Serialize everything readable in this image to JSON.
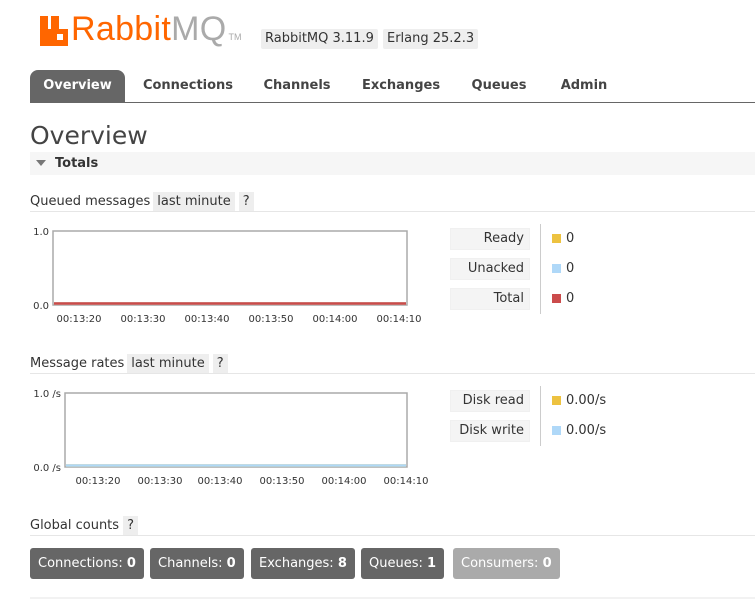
{
  "header": {
    "logo_primary": "Rabbit",
    "logo_secondary": "MQ",
    "logo_tm": "TM",
    "version_rabbitmq": "RabbitMQ 3.11.9",
    "version_erlang": "Erlang 25.2.3"
  },
  "tabs": [
    {
      "label": "Overview",
      "active": true
    },
    {
      "label": "Connections",
      "active": false
    },
    {
      "label": "Channels",
      "active": false
    },
    {
      "label": "Exchanges",
      "active": false
    },
    {
      "label": "Queues",
      "active": false
    },
    {
      "label": "Admin",
      "active": false
    }
  ],
  "page_title": "Overview",
  "section": {
    "label": "Totals"
  },
  "queued": {
    "label": "Queued messages",
    "range": "last minute",
    "help": "?",
    "legend": [
      {
        "label": "Ready",
        "value": "0",
        "color": "#edc240"
      },
      {
        "label": "Unacked",
        "value": "0",
        "color": "#afd8f8"
      },
      {
        "label": "Total",
        "value": "0",
        "color": "#cb4b4b"
      }
    ]
  },
  "rates": {
    "label": "Message rates",
    "range": "last minute",
    "help": "?",
    "legend": [
      {
        "label": "Disk read",
        "value": "0.00/s",
        "color": "#edc240"
      },
      {
        "label": "Disk write",
        "value": "0.00/s",
        "color": "#afd8f8"
      }
    ]
  },
  "global": {
    "label": "Global counts",
    "help": "?",
    "counts": [
      {
        "label": "Connections:",
        "value": "0",
        "disabled": false
      },
      {
        "label": "Channels:",
        "value": "0",
        "disabled": false
      },
      {
        "label": "Exchanges:",
        "value": "8",
        "disabled": false
      },
      {
        "label": "Queues:",
        "value": "1",
        "disabled": false
      },
      {
        "label": "Consumers:",
        "value": "0",
        "disabled": true
      }
    ]
  },
  "chart_data": [
    {
      "type": "line",
      "x": [
        "00:13:20",
        "00:13:30",
        "00:13:40",
        "00:13:50",
        "00:14:00",
        "00:14:10"
      ],
      "ylim": [
        0.0,
        1.0
      ],
      "ytick_labels": [
        "1.0",
        "0.0"
      ],
      "series": [
        {
          "name": "Ready",
          "values": [
            0,
            0,
            0,
            0,
            0,
            0
          ],
          "color": "#edc240"
        },
        {
          "name": "Unacked",
          "values": [
            0,
            0,
            0,
            0,
            0,
            0
          ],
          "color": "#afd8f8"
        },
        {
          "name": "Total",
          "values": [
            0,
            0,
            0,
            0,
            0,
            0
          ],
          "color": "#cb4b4b"
        }
      ]
    },
    {
      "type": "line",
      "x": [
        "00:13:20",
        "00:13:30",
        "00:13:40",
        "00:13:50",
        "00:14:00",
        "00:14:10"
      ],
      "ylim": [
        0.0,
        1.0
      ],
      "ytick_labels": [
        "1.0 /s",
        "0.0 /s"
      ],
      "series": [
        {
          "name": "Disk read",
          "values": [
            0,
            0,
            0,
            0,
            0,
            0
          ],
          "color": "#edc240"
        },
        {
          "name": "Disk write",
          "values": [
            0,
            0,
            0,
            0,
            0,
            0
          ],
          "color": "#afd8f8"
        }
      ]
    }
  ]
}
